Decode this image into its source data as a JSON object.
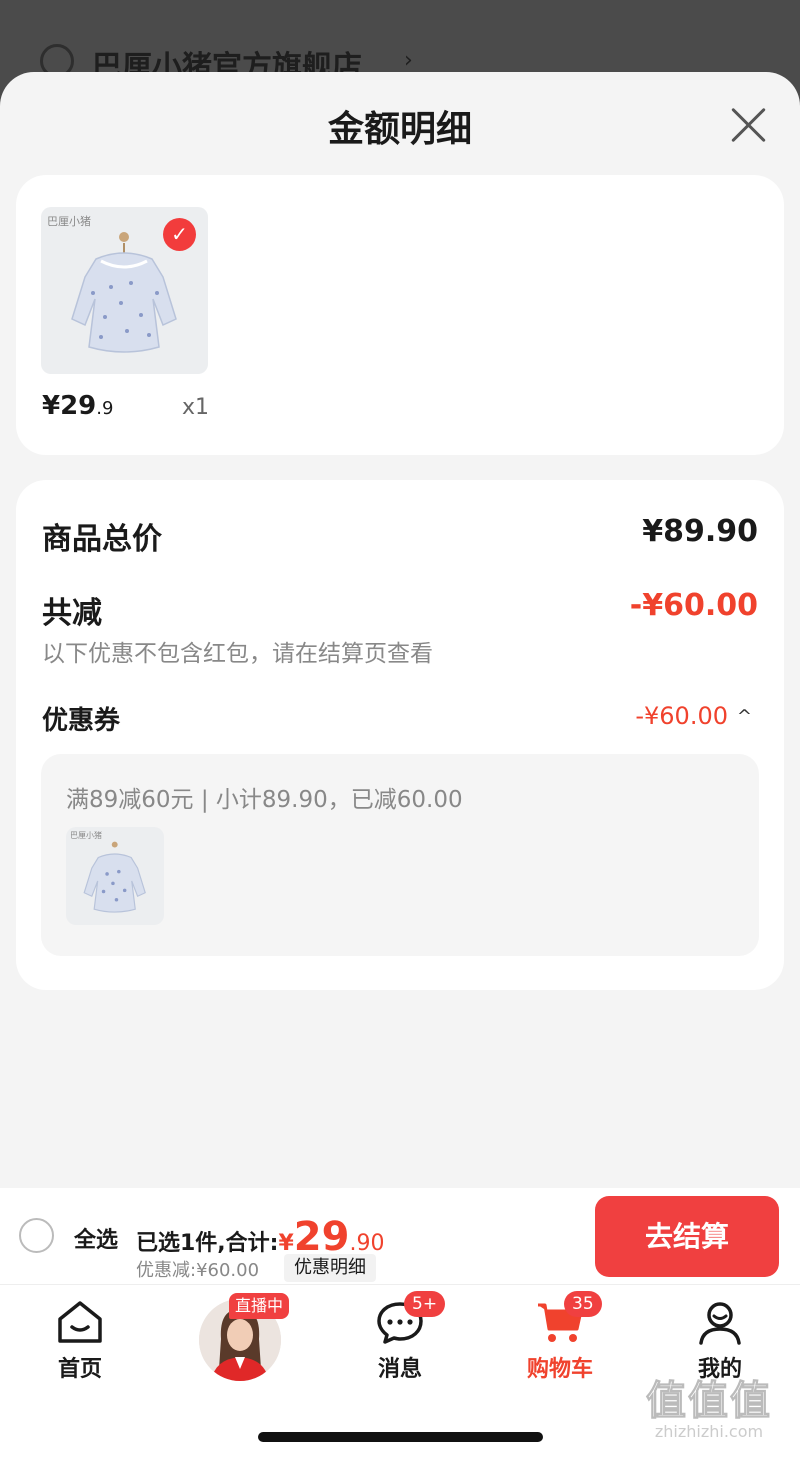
{
  "background_header": {
    "store_name": "巴厘小猪官方旗舰店",
    "chevron": "›"
  },
  "sheet": {
    "title": "金额明细"
  },
  "items": [
    {
      "brand": "巴厘小猪",
      "price_int": "¥29",
      "price_dec": ".9",
      "qty": "x1",
      "checked_mark": "✓"
    }
  ],
  "summary": {
    "goods_total_label": "商品总价",
    "goods_total_value": "¥89.90",
    "reduced_label": "共减",
    "reduced_value": "-¥60.00",
    "note": "以下优惠不包含红包，请在结算页查看",
    "coupon_label": "优惠券",
    "coupon_value": "-¥60.00",
    "coupon_chevron": "^",
    "coupon_detail": "满89减60元 | 小计89.90，已减60.00",
    "coupon_thumb_brand": "巴厘小猪"
  },
  "checkout": {
    "select_all": "全选",
    "selected_text": "已选1件,合计:",
    "total_symbol": "¥",
    "total_int": "29",
    "total_dec": ".90",
    "discount_text": "优惠减:¥60.00",
    "detail_button": "优惠明细",
    "pay_button": "去结算"
  },
  "tabbar": {
    "home": "首页",
    "live_badge": "直播中",
    "messages": "消息",
    "messages_badge": "5+",
    "cart": "购物车",
    "cart_badge": "35",
    "mine": "我的"
  },
  "watermark": {
    "big": "值值值",
    "small": "zhizhizhi.com"
  },
  "colors": {
    "accent": "#f0422d",
    "button": "#f04040",
    "sheet_bg": "#f4f4f4"
  }
}
